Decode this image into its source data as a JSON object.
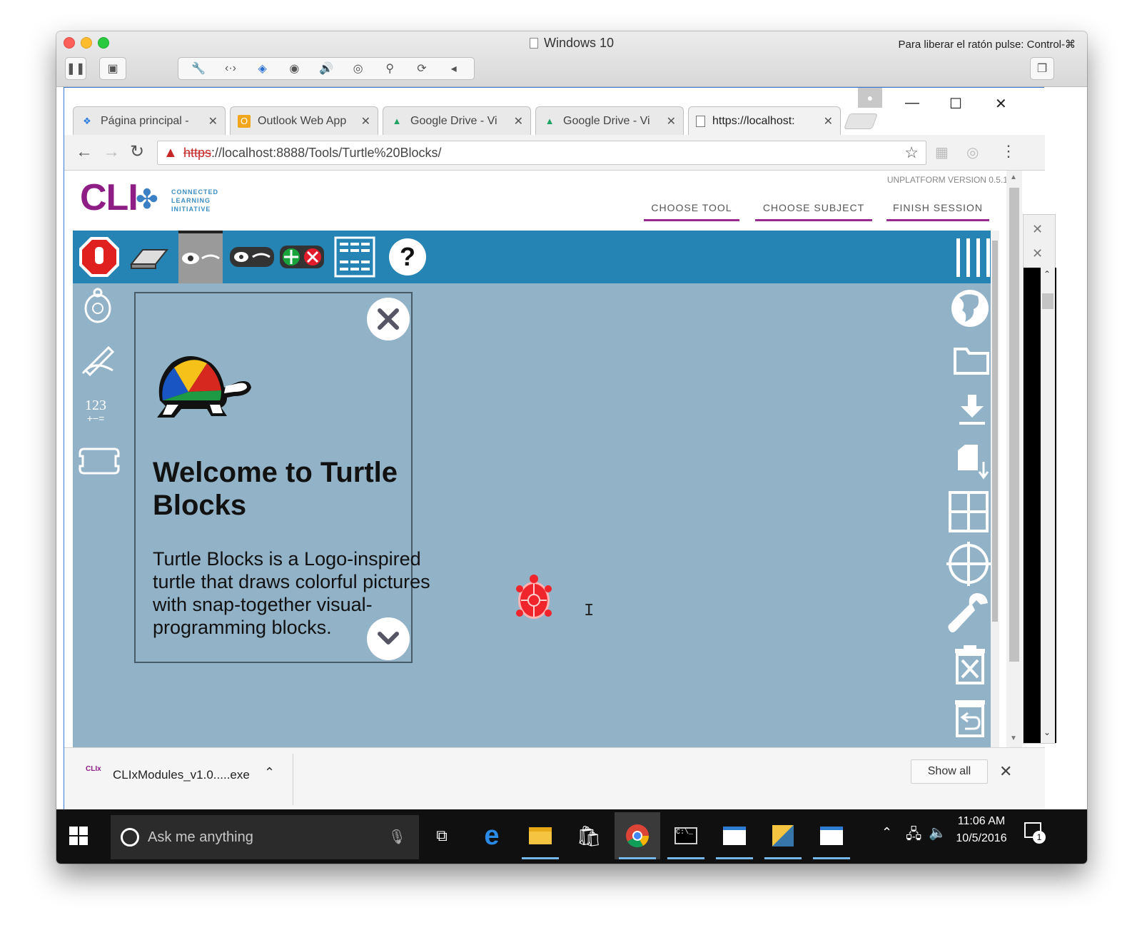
{
  "mac_window": {
    "title": "Windows 10",
    "hint": "Para liberar el ratón pulse: Control-⌘"
  },
  "browser": {
    "tabs": [
      {
        "label": "Página principal -",
        "favicon": "dropbox-icon"
      },
      {
        "label": "Outlook Web App",
        "favicon": "outlook-icon"
      },
      {
        "label": "Google Drive - Vi",
        "favicon": "google-drive-icon"
      },
      {
        "label": "Google Drive - Vi",
        "favicon": "google-drive-icon"
      },
      {
        "label": "https://localhost:",
        "favicon": "page-icon"
      }
    ],
    "url_scheme": "https",
    "url_rest": "://localhost:8888/Tools/Turtle%20Blocks/"
  },
  "site": {
    "logo_text": "CLI",
    "logo_subtitle_1": "CONNECTED",
    "logo_subtitle_2": "LEARNING",
    "logo_subtitle_3": "INITIATIVE",
    "version": "UNPLATFORM VERSION 0.5.1",
    "nav": [
      "CHOOSE TOOL",
      "CHOOSE SUBJECT",
      "FINISH SESSION"
    ]
  },
  "turtle_blocks": {
    "toolbar_icons": [
      "stop-icon",
      "eraser-icon",
      "hide-blocks-icon",
      "slow-run-icon",
      "collapse-expand-icon",
      "grid-menu-icon",
      "help-icon"
    ],
    "palette": {
      "numbers_label": "123",
      "numbers_ops": "+−="
    },
    "welcome_title": "Welcome to Turtle Blocks",
    "welcome_body": "Turtle Blocks is a Logo-inspired turtle that draws colorful pictures with snap-together visual-programming blocks."
  },
  "download_bar": {
    "filename": "CLIxModules_v1.0.....exe",
    "show_all": "Show all"
  },
  "taskbar": {
    "search_placeholder": "Ask me anything",
    "time": "11:06 AM",
    "date": "10/5/2016",
    "notification_count": "1"
  }
}
